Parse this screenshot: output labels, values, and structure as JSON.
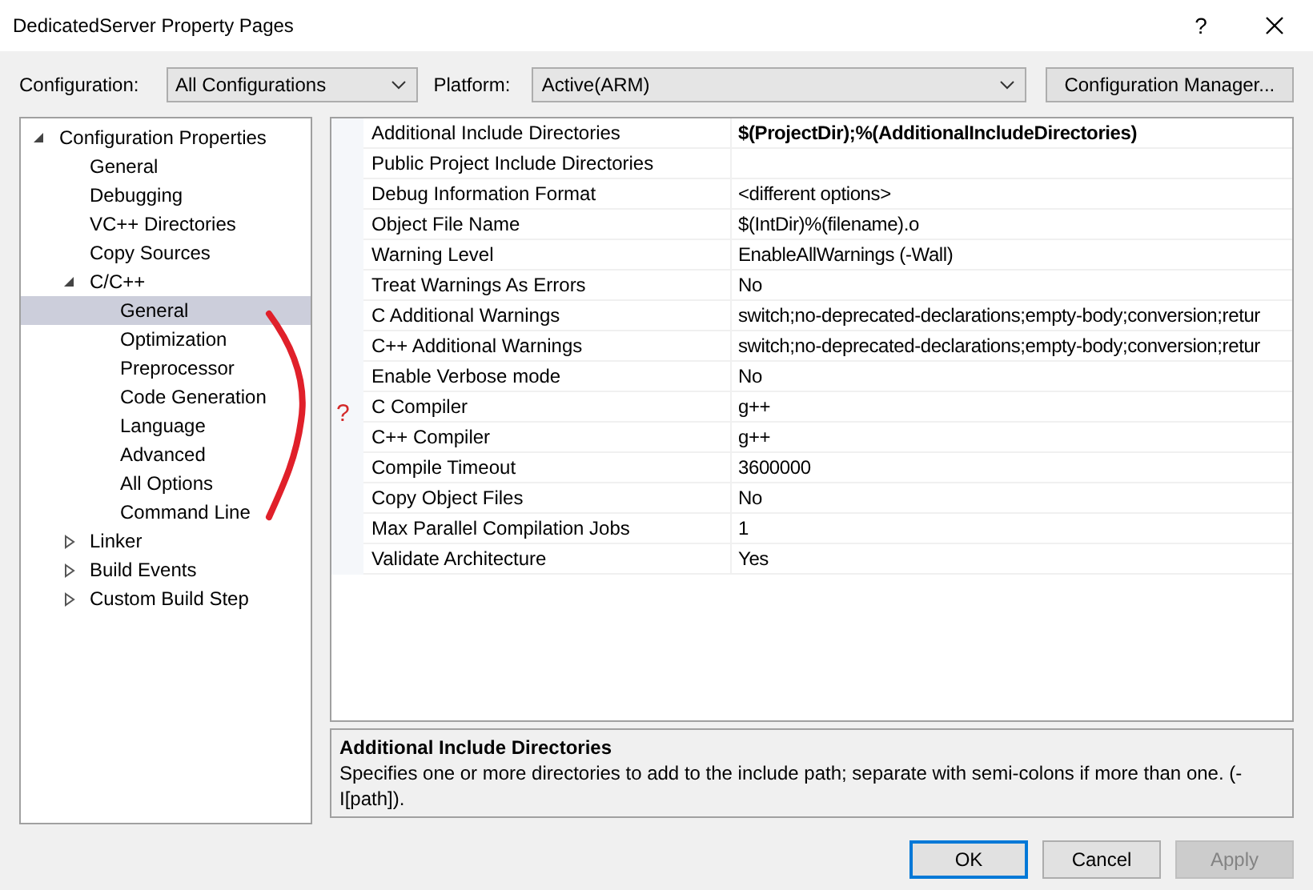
{
  "window": {
    "title": "DedicatedServer Property Pages",
    "help": "?"
  },
  "configuration": {
    "label": "Configuration:",
    "value": "All Configurations"
  },
  "platform": {
    "label": "Platform:",
    "value": "Active(ARM)"
  },
  "configuration_manager": "Configuration Manager...",
  "tree": [
    {
      "label": "Configuration Properties",
      "expanded": true,
      "selected": false,
      "children": [
        {
          "label": "General",
          "selected": false
        },
        {
          "label": "Debugging",
          "selected": false
        },
        {
          "label": "VC++ Directories",
          "selected": false
        },
        {
          "label": "Copy Sources",
          "selected": false
        },
        {
          "label": "C/C++",
          "expanded": true,
          "selected": false,
          "children": [
            {
              "label": "General",
              "selected": true
            },
            {
              "label": "Optimization",
              "selected": false
            },
            {
              "label": "Preprocessor",
              "selected": false
            },
            {
              "label": "Code Generation",
              "selected": false
            },
            {
              "label": "Language",
              "selected": false
            },
            {
              "label": "Advanced",
              "selected": false
            },
            {
              "label": "All Options",
              "selected": false
            },
            {
              "label": "Command Line",
              "selected": false
            }
          ]
        },
        {
          "label": "Linker",
          "expanded": false,
          "selected": false
        },
        {
          "label": "Build Events",
          "expanded": false,
          "selected": false
        },
        {
          "label": "Custom Build Step",
          "expanded": false,
          "selected": false
        }
      ]
    }
  ],
  "properties": [
    {
      "name": "Additional Include Directories",
      "value": "$(ProjectDir);%(AdditionalIncludeDirectories)",
      "modified": true
    },
    {
      "name": "Public Project Include Directories"
    },
    {
      "name": "Debug Information Format",
      "value": "<different options>",
      "modified": false
    },
    {
      "name": "Object File Name",
      "value": "$(IntDir)%(filename).o",
      "modified": false
    },
    {
      "name": "Warning Level",
      "value": "EnableAllWarnings (-Wall)",
      "modified": false
    },
    {
      "name": "Treat Warnings As Errors",
      "value": "No",
      "modified": false
    },
    {
      "name": "C Additional Warnings",
      "value": "switch;no-deprecated-declarations;empty-body;conversion;retur",
      "modified": false
    },
    {
      "name": "C++ Additional Warnings",
      "value": "switch;no-deprecated-declarations;empty-body;conversion;retur",
      "modified": false
    },
    {
      "name": "Enable Verbose mode",
      "value": "No",
      "modified": false
    },
    {
      "name": "C Compiler",
      "value": "g++",
      "modified": false
    },
    {
      "name": "C++ Compiler",
      "value": "g++",
      "modified": false
    },
    {
      "name": "Compile Timeout",
      "value": "3600000",
      "modified": false
    },
    {
      "name": "Copy Object Files",
      "value": "No",
      "modified": false
    },
    {
      "name": "Max Parallel Compilation Jobs",
      "value": "1",
      "modified": false
    },
    {
      "name": "Validate Architecture",
      "value": "Yes",
      "modified": false
    }
  ],
  "description": {
    "title": "Additional Include Directories",
    "text": "Specifies one or more directories to add to the include path; separate with semi-colons if more than one. (-I[path])."
  },
  "annotation": {
    "mark": "?"
  },
  "buttons": [
    {
      "label": "OK",
      "default": true,
      "disabled": false
    },
    {
      "label": "Cancel",
      "default": false,
      "disabled": false
    },
    {
      "label": "Apply",
      "disabled": true
    }
  ]
}
